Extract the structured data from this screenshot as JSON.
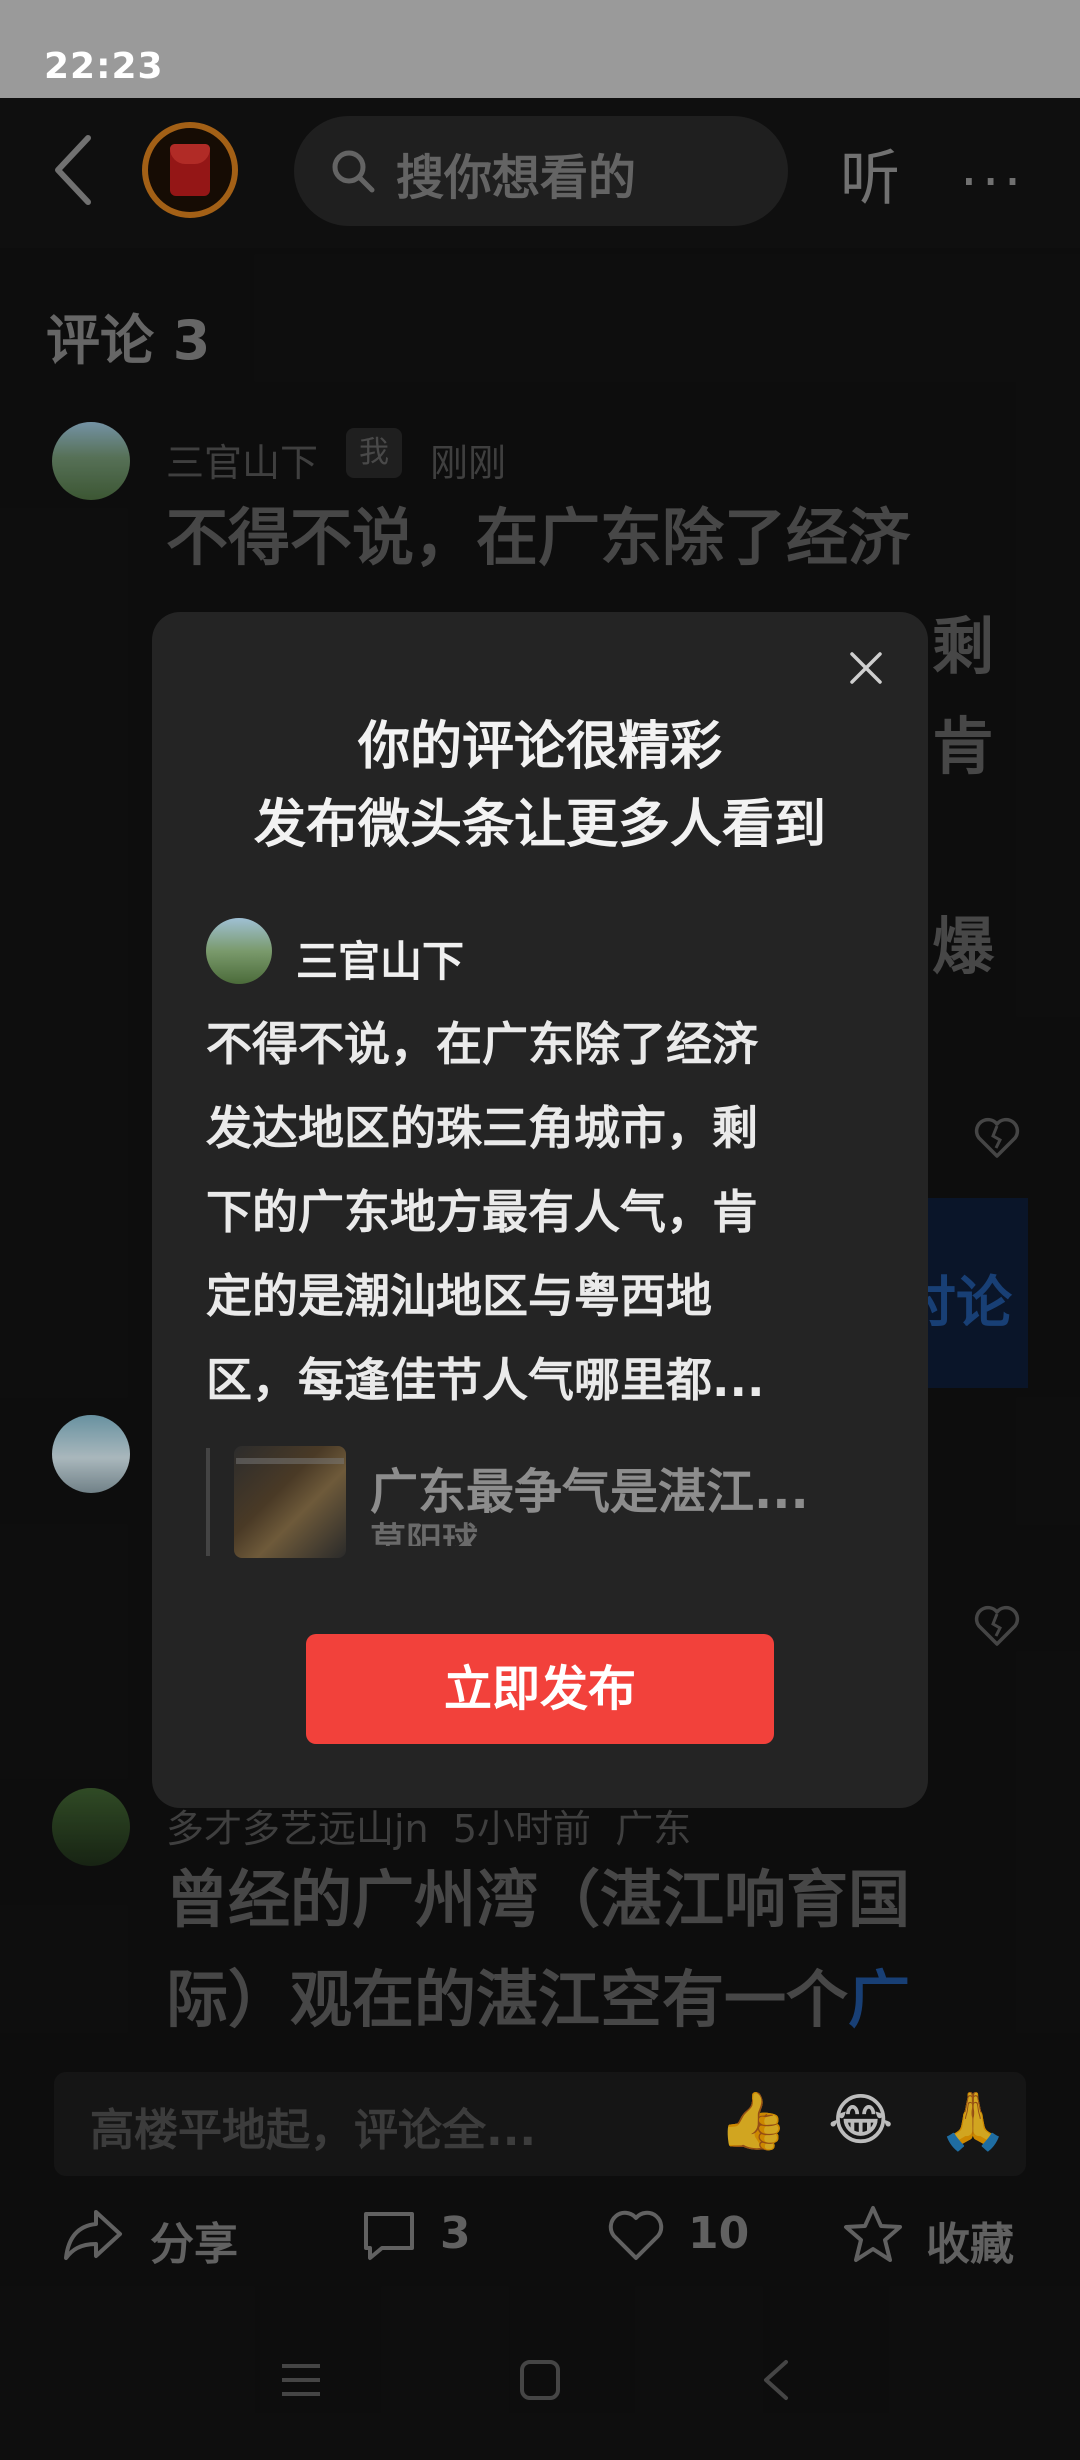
{
  "status_bar": {
    "time": "22:23"
  },
  "top_bar": {
    "search_placeholder": "搜你想看的",
    "listen_label": "听",
    "more_label": "···"
  },
  "comments": {
    "title": "评论 3",
    "items": [
      {
        "user": "三官山下",
        "badge": "我",
        "time": "刚刚",
        "text": "不得不说，在广东除了经济"
      },
      {
        "user": "多才多艺远山jn",
        "time": "5小时前",
        "location": "广东",
        "text_line1": "曾经的广州湾（湛江响育国",
        "text_line2": "际）观在的湛江空有一个",
        "link_fragment": "广"
      }
    ],
    "occluded_fragments": {
      "right_1": "剩",
      "right_2": "肯",
      "right_3": "爆",
      "discuss": "讨论"
    }
  },
  "input_bar": {
    "placeholder": "高楼平地起，评论全...",
    "emojis": [
      "👍",
      "😂",
      "🙏"
    ]
  },
  "actions": {
    "share": "分享",
    "comment_count": "3",
    "like_count": "10",
    "favorite": "收藏"
  },
  "dialog": {
    "title_line1": "你的评论很精彩",
    "title_line2": "发布微头条让更多人看到",
    "user": "三官山下",
    "text": "不得不说，在广东除了经济\n发达地区的珠三角城市，剩\n下的广东地方最有人气，肯\n定的是潮汕地区与粤西地\n区，每逢佳节人气哪里都...",
    "article_title": "广东最争气是湛江...",
    "article_source": "草阳球",
    "publish_label": "立即发布"
  },
  "colors": {
    "accent_red": "#f2413b",
    "status_bar": "#9a9a9a",
    "background": "#111111",
    "dialog_bg": "#242424"
  },
  "icons": [
    "back-chevron-icon",
    "red-packet-icon",
    "search-icon",
    "more-icon",
    "close-icon",
    "heart-icon",
    "share-icon",
    "comment-icon",
    "like-icon",
    "star-icon",
    "menu-icon",
    "home-icon",
    "back-icon"
  ]
}
